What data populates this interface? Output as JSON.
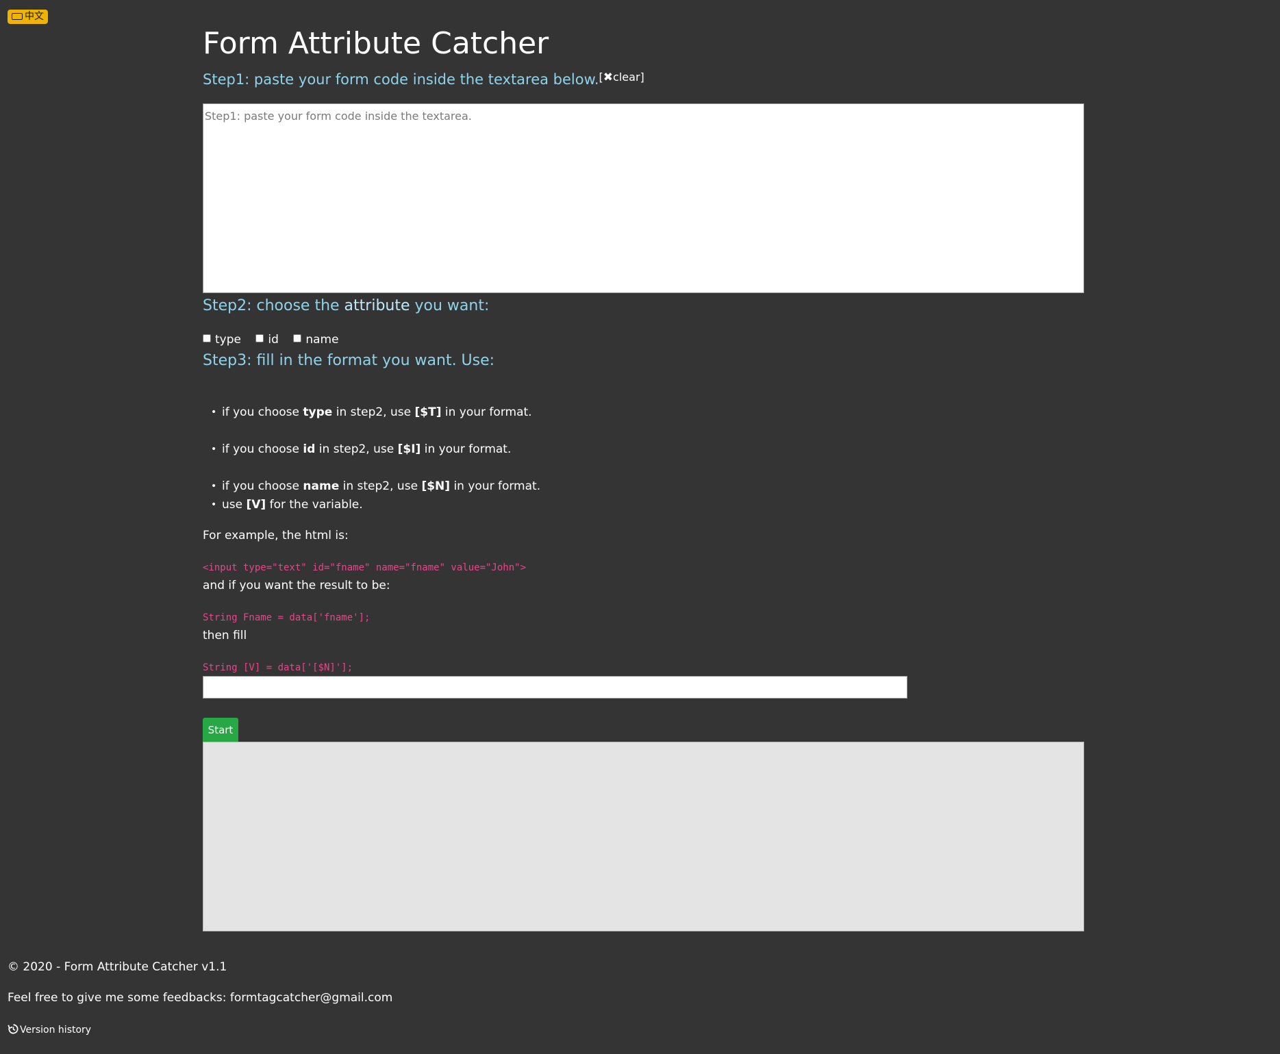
{
  "lang_badge": {
    "label": "中文"
  },
  "page_title": "Form Attribute Catcher",
  "step1": {
    "text": "Step1: paste your form code inside the textarea below.",
    "clear_open": "[",
    "clear_x": "✖",
    "clear_label": "clear]",
    "placeholder": "Step1: paste your form code inside the textarea."
  },
  "step2": {
    "prefix": "Step2: choose the ",
    "highlight": "attribute",
    "suffix": " you want:",
    "options": [
      "type",
      "id",
      "name"
    ]
  },
  "step3": {
    "text": "Step3: fill in the format you want. Use:"
  },
  "rules": [
    {
      "a": "if you choose ",
      "b": "type",
      "c": " in step2, use ",
      "d": "[$T]",
      "e": " in your format."
    },
    {
      "a": "if you choose ",
      "b": "id",
      "c": " in step2, use ",
      "d": "[$I]",
      "e": " in your format."
    },
    {
      "a": "if you choose ",
      "b": "name",
      "c": " in step2, use ",
      "d": "[$N]",
      "e": " in your format."
    },
    {
      "a": "use ",
      "b": "[V]",
      "c": " for the variable."
    }
  ],
  "example": {
    "intro": "For example, the html is:",
    "html_code": "<input type=\"text\" id=\"fname\" name=\"fname\" value=\"John\">",
    "result_intro": "and if you want the result to be:",
    "result_code": "String Fname = data['fname'];",
    "fill_intro": "then fill",
    "fill_code": "String [V] = data['[$N]'];"
  },
  "format_input": {
    "value": ""
  },
  "start_button": {
    "label": "Start"
  },
  "footer": {
    "copyright": "© 2020 - Form Attribute Catcher v1.1",
    "feedback": "Feel free to give me some feedbacks: formtagcatcher@gmail.com",
    "version_history": "Version history"
  }
}
